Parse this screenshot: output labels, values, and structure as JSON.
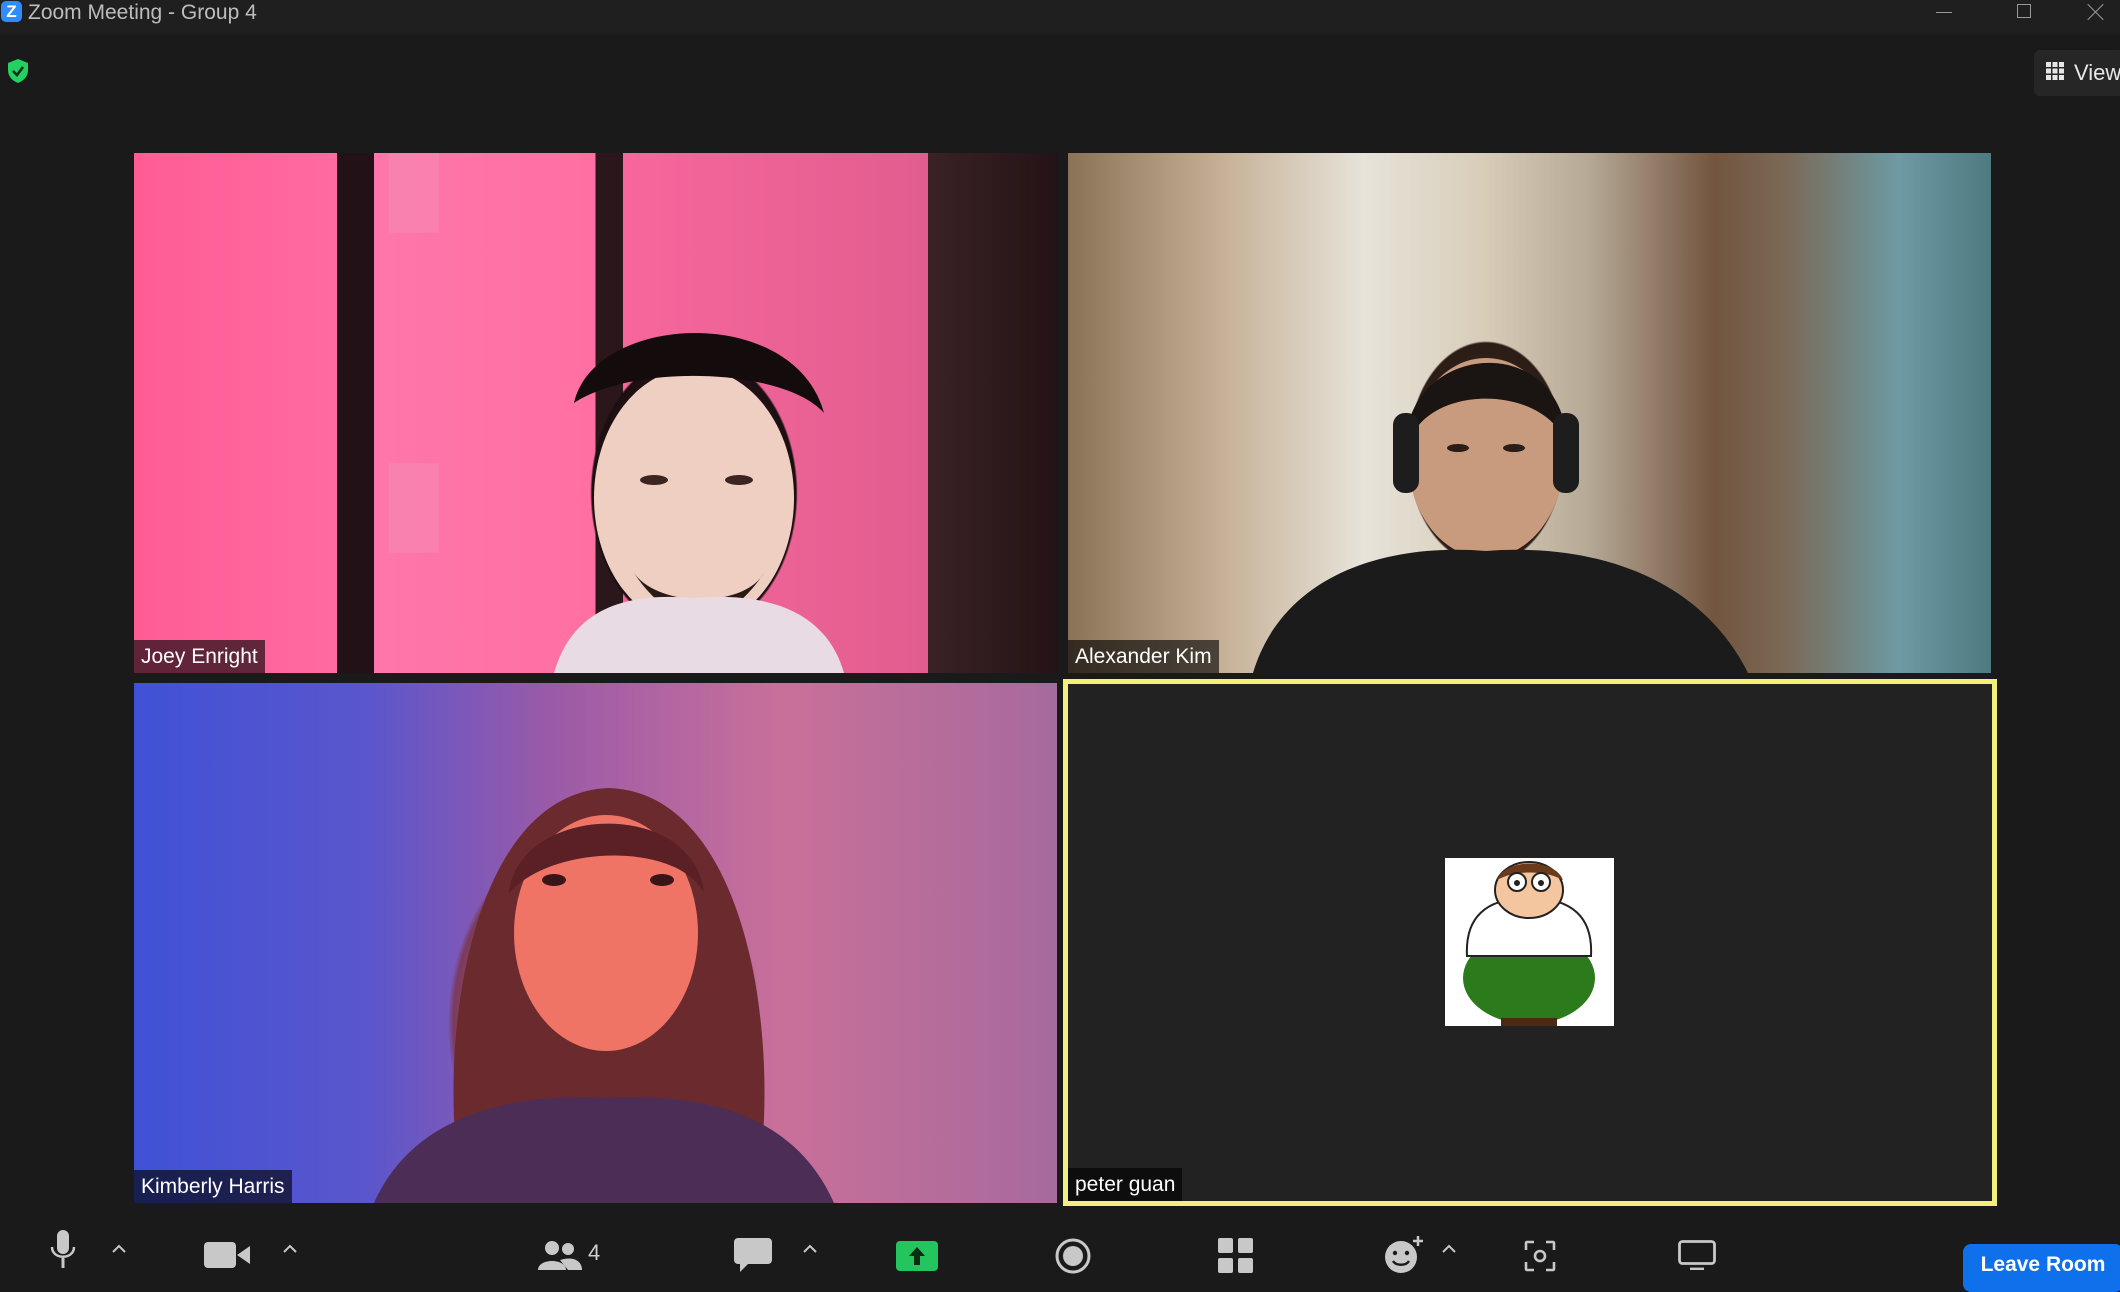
{
  "window": {
    "title": "Zoom Meeting - Group 4",
    "logo_letter": "Z"
  },
  "top_bar": {
    "view_label": "View",
    "security_status": "encrypted"
  },
  "participants": [
    {
      "name": "Joey Enright",
      "video": "on"
    },
    {
      "name": "Alexander Kim",
      "video": "on"
    },
    {
      "name": "Kimberly Harris",
      "video": "on"
    },
    {
      "name": "peter guan",
      "video": "off",
      "active_speaker": true,
      "avatar": "cartoon-avatar"
    }
  ],
  "toolbar": {
    "participants_count": "4",
    "leave_label": "Leave Room",
    "icons": [
      "microphone-icon",
      "video-camera-icon",
      "participants-icon",
      "chat-icon",
      "share-screen-icon",
      "record-icon",
      "apps-icon",
      "reactions-icon",
      "whiteboard-icon",
      "more-icon"
    ]
  },
  "colors": {
    "active_speaker_border": "#f2f07a",
    "share_green": "#22c55e",
    "leave_blue": "#0e71eb",
    "security_green": "#23d160"
  }
}
